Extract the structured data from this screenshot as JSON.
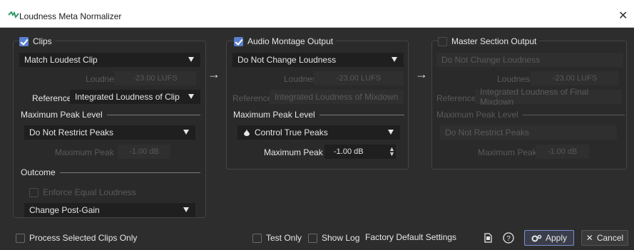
{
  "window": {
    "title": "Loudness Meta Normalizer",
    "close_glyph": "✕"
  },
  "clips": {
    "title": "Clips",
    "checked": true,
    "mode": "Match Loudest Clip",
    "loudness_label": "Loudness",
    "loudness_value": "-23.00 LUFS",
    "reference_label": "Reference",
    "reference_value": "Integrated Loudness of Clip",
    "max_peak_section": "Maximum Peak Level",
    "peak_mode": "Do Not Restrict Peaks",
    "max_peak_label": "Maximum Peak",
    "max_peak_value": "-1.00 dB",
    "outcome_section": "Outcome",
    "enforce_label": "Enforce Equal Loudness",
    "outcome_mode": "Change Post-Gain"
  },
  "montage": {
    "title": "Audio Montage Output",
    "checked": true,
    "mode": "Do Not Change Loudness",
    "loudness_label": "Loudness",
    "loudness_value": "-23.00 LUFS",
    "reference_label": "Reference",
    "reference_value": "Integrated Loudness of Mixdown",
    "max_peak_section": "Maximum Peak Level",
    "peak_mode": "Control True Peaks",
    "max_peak_label": "Maximum Peak",
    "max_peak_value": "-1.00 dB"
  },
  "master": {
    "title": "Master Section Output",
    "checked": false,
    "mode": "Do Not Change Loudness",
    "loudness_label": "Loudness",
    "loudness_value": "-23.00 LUFS",
    "reference_label": "Reference",
    "reference_value": "Integrated Loudness of Final Mixdown",
    "max_peak_section": "Maximum Peak Level",
    "peak_mode": "Do Not Restrict Peaks",
    "max_peak_label": "Maximum Peak",
    "max_peak_value": "-1.00 dB"
  },
  "footer": {
    "process_selected_label": "Process Selected Clips Only",
    "test_only_label": "Test Only",
    "show_log_label": "Show Log",
    "preset_label": "Factory Default Settings",
    "apply_label": "Apply",
    "cancel_label": "Cancel"
  },
  "arrow_glyph": "→",
  "colors": {
    "accent": "#5a7fd0",
    "background": "#2d2d2d",
    "field": "#1f1f1f"
  }
}
